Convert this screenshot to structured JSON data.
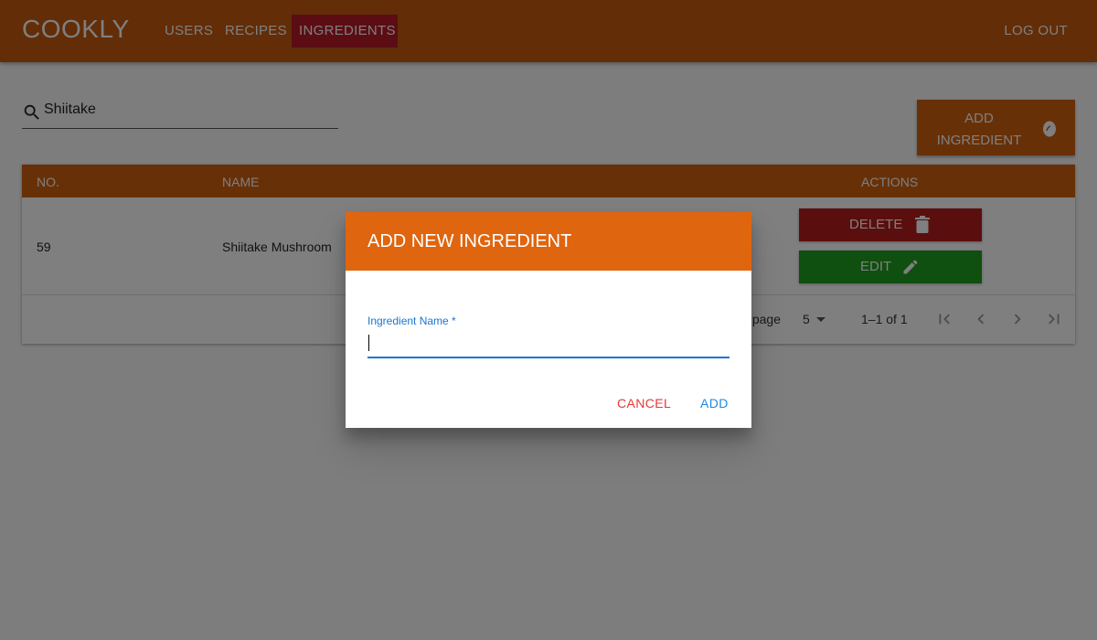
{
  "app": {
    "title": "COOKLY"
  },
  "nav": {
    "users": "USERS",
    "recipes": "RECIPES",
    "ingredients": "INGREDIENTS",
    "logout": "LOG OUT",
    "active": "INGREDIENTS"
  },
  "search": {
    "value": "Shiitake",
    "icon": "search-icon"
  },
  "add_ingredient_button": {
    "line1": "ADD",
    "line2": "INGREDIENT",
    "icon": "egg-icon"
  },
  "table": {
    "headers": {
      "no": "NO.",
      "name": "NAME",
      "actions": "ACTIONS"
    },
    "rows": [
      {
        "no": "59",
        "name": "Shiitake Mushroom",
        "delete_label": "DELETE",
        "edit_label": "EDIT"
      }
    ]
  },
  "pagination": {
    "rows_per_page_label": "page:",
    "rows_per_page": "5",
    "range": "1–1 of 1"
  },
  "dialog": {
    "title": "ADD NEW INGREDIENT",
    "field_label": "Ingredient Name *",
    "field_value": "",
    "cancel": "CANCEL",
    "add": "ADD"
  },
  "colors": {
    "appbar": "#c55a0f",
    "nav_active": "#b61b26",
    "delete": "#b71c1c",
    "edit": "#1e9e1e",
    "dialog_header": "#e0650f",
    "focus": "#1976d2"
  }
}
